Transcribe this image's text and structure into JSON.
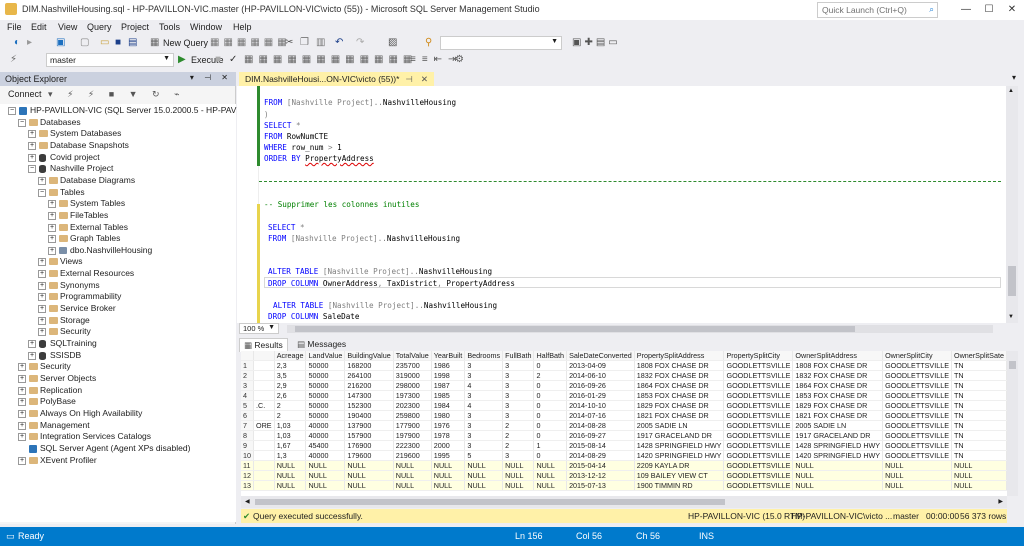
{
  "window": {
    "title": "DIM.NashvilleHousing.sql - HP-PAVILLON-VIC.master (HP-PAVILLON-VIC\\victo (55)) - Microsoft SQL Server Management Studio",
    "quick_launch_placeholder": "Quick Launch (Ctrl+Q)"
  },
  "menu": [
    "File",
    "Edit",
    "View",
    "Query",
    "Project",
    "Tools",
    "Window",
    "Help"
  ],
  "toolbar": {
    "new_query": "New Query",
    "database": "master",
    "execute": "Execute"
  },
  "object_explorer": {
    "title": "Object Explorer",
    "connect": "Connect",
    "nodes": [
      {
        "label": "HP-PAVILLON-VIC (SQL Server 15.0.2000.5 - HP-PAVILLON-",
        "icon": "server-icon",
        "exp": "−"
      },
      {
        "label": "Databases",
        "icon": "folder-icon",
        "exp": "−"
      },
      {
        "label": "System Databases",
        "icon": "folder-icon",
        "exp": "+"
      },
      {
        "label": "Database Snapshots",
        "icon": "folder-icon",
        "exp": "+"
      },
      {
        "label": "Covid project",
        "icon": "database-icon",
        "exp": "+"
      },
      {
        "label": "Nashville Project",
        "icon": "database-icon",
        "exp": "−"
      },
      {
        "label": "Database Diagrams",
        "icon": "folder-icon",
        "exp": "+"
      },
      {
        "label": "Tables",
        "icon": "folder-icon",
        "exp": "−"
      },
      {
        "label": "System Tables",
        "icon": "folder-icon",
        "exp": "+"
      },
      {
        "label": "FileTables",
        "icon": "folder-icon",
        "exp": "+"
      },
      {
        "label": "External Tables",
        "icon": "folder-icon",
        "exp": "+"
      },
      {
        "label": "Graph Tables",
        "icon": "folder-icon",
        "exp": "+"
      },
      {
        "label": "dbo.NashvilleHousing",
        "icon": "table-icon",
        "exp": "+"
      },
      {
        "label": "Views",
        "icon": "folder-icon",
        "exp": "+"
      },
      {
        "label": "External Resources",
        "icon": "folder-icon",
        "exp": "+"
      },
      {
        "label": "Synonyms",
        "icon": "folder-icon",
        "exp": "+"
      },
      {
        "label": "Programmability",
        "icon": "folder-icon",
        "exp": "+"
      },
      {
        "label": "Service Broker",
        "icon": "folder-icon",
        "exp": "+"
      },
      {
        "label": "Storage",
        "icon": "folder-icon",
        "exp": "+"
      },
      {
        "label": "Security",
        "icon": "folder-icon",
        "exp": "+"
      },
      {
        "label": "SQLTraining",
        "icon": "database-icon",
        "exp": "+"
      },
      {
        "label": "SSISDB",
        "icon": "database-icon",
        "exp": "+"
      },
      {
        "label": "Security",
        "icon": "folder-icon",
        "exp": "+"
      },
      {
        "label": "Server Objects",
        "icon": "folder-icon",
        "exp": "+"
      },
      {
        "label": "Replication",
        "icon": "folder-icon",
        "exp": "+"
      },
      {
        "label": "PolyBase",
        "icon": "folder-icon",
        "exp": "+"
      },
      {
        "label": "Always On High Availability",
        "icon": "folder-icon",
        "exp": "+"
      },
      {
        "label": "Management",
        "icon": "folder-icon",
        "exp": "+"
      },
      {
        "label": "Integration Services Catalogs",
        "icon": "folder-icon",
        "exp": "+"
      },
      {
        "label": "SQL Server Agent (Agent XPs disabled)",
        "icon": "agent-icon",
        "exp": ""
      },
      {
        "label": "XEvent Profiler",
        "icon": "folder-icon",
        "exp": "+"
      }
    ]
  },
  "editor": {
    "tab_label": "DIM.NashvilleHousi...ON-VIC\\victo (55))*",
    "zoom": "100 %",
    "lines": [
      "FROM [Nashville Project]..NashvilleHousing",
      ")",
      "SELECT *",
      "FROM RowNumCTE",
      "WHERE row_num > 1",
      "ORDER BY PropertyAddress",
      "-- Supprimer les colonnes inutiles",
      "SELECT *",
      "FROM [Nashville Project]..NashvilleHousing",
      "ALTER TABLE [Nashville Project]..NashvilleHousing",
      "DROP COLUMN OwnerAddress, TaxDistrict, PropertyAddress",
      "ALTER TABLE [Nashville Project]..NashvilleHousing",
      "DROP COLUMN SaleDate"
    ]
  },
  "results": {
    "tabs": [
      "Results",
      "Messages"
    ],
    "columns": [
      "",
      "",
      "Acreage",
      "LandValue",
      "BuildingValue",
      "TotalValue",
      "YearBuilt",
      "Bedrooms",
      "FullBath",
      "HalfBath",
      "SaleDateConverted",
      "PropertySplitAddress",
      "PropertySplitCity",
      "OwnerSplitAddress",
      "OwnerSplitCity",
      "OwnerSplitSate"
    ],
    "rows": [
      [
        "1",
        "",
        "2,3",
        "50000",
        "168200",
        "235700",
        "1986",
        "3",
        "3",
        "0",
        "2013-04-09",
        "1808  FOX CHASE DR",
        "GOODLETTSVILLE",
        "1808  FOX CHASE DR",
        "GOODLETTSVILLE",
        "TN"
      ],
      [
        "2",
        "",
        "3,5",
        "50000",
        "264100",
        "319000",
        "1998",
        "3",
        "3",
        "2",
        "2014-06-10",
        "1832  FOX CHASE DR",
        "GOODLETTSVILLE",
        "1832  FOX CHASE DR",
        "GOODLETTSVILLE",
        "TN"
      ],
      [
        "3",
        "",
        "2,9",
        "50000",
        "216200",
        "298000",
        "1987",
        "4",
        "3",
        "0",
        "2016-09-26",
        "1864 FOX CHASE  DR",
        "GOODLETTSVILLE",
        "1864  FOX CHASE DR",
        "GOODLETTSVILLE",
        "TN"
      ],
      [
        "4",
        "",
        "2,6",
        "50000",
        "147300",
        "197300",
        "1985",
        "3",
        "3",
        "0",
        "2016-01-29",
        "1853  FOX CHASE DR",
        "GOODLETTSVILLE",
        "1853  FOX CHASE DR",
        "GOODLETTSVILLE",
        "TN"
      ],
      [
        "5",
        ".C.",
        "2",
        "50000",
        "152300",
        "202300",
        "1984",
        "4",
        "3",
        "0",
        "2014-10-10",
        "1829  FOX CHASE DR",
        "GOODLETTSVILLE",
        "1829  FOX CHASE DR",
        "GOODLETTSVILLE",
        "TN"
      ],
      [
        "6",
        "",
        "2",
        "50000",
        "190400",
        "259800",
        "1980",
        "3",
        "3",
        "0",
        "2014-07-16",
        "1821  FOX CHASE DR",
        "GOODLETTSVILLE",
        "1821  FOX CHASE DR",
        "GOODLETTSVILLE",
        "TN"
      ],
      [
        "7",
        "ORE",
        "1,03",
        "40000",
        "137900",
        "177900",
        "1976",
        "3",
        "2",
        "0",
        "2014-08-28",
        "2005  SADIE LN",
        "GOODLETTSVILLE",
        "2005  SADIE LN",
        "GOODLETTSVILLE",
        "TN"
      ],
      [
        "8",
        "",
        "1,03",
        "40000",
        "157900",
        "197900",
        "1978",
        "3",
        "2",
        "0",
        "2016-09-27",
        "1917 GRACELAND  DR",
        "GOODLETTSVILLE",
        "1917  GRACELAND DR",
        "GOODLETTSVILLE",
        "TN"
      ],
      [
        "9",
        "",
        "1,67",
        "45400",
        "176900",
        "222300",
        "2000",
        "3",
        "2",
        "1",
        "2015-08-14",
        "1428  SPRINGFIELD HWY",
        "GOODLETTSVILLE",
        "1428  SPRINGFIELD HWY",
        "GOODLETTSVILLE",
        "TN"
      ],
      [
        "10",
        "",
        "1,3",
        "40000",
        "179600",
        "219600",
        "1995",
        "5",
        "3",
        "0",
        "2014-08-29",
        "1420  SPRINGFIELD HWY",
        "GOODLETTSVILLE",
        "1420  SPRINGFIELD HWY",
        "GOODLETTSVILLE",
        "TN"
      ],
      [
        "11",
        "",
        "NULL",
        "NULL",
        "NULL",
        "NULL",
        "NULL",
        "NULL",
        "NULL",
        "NULL",
        "2015-04-14",
        "2209  KAYLA DR",
        "GOODLETTSVILLE",
        "NULL",
        "NULL",
        "NULL"
      ],
      [
        "12",
        "",
        "NULL",
        "NULL",
        "NULL",
        "NULL",
        "NULL",
        "NULL",
        "NULL",
        "NULL",
        "2013-12-12",
        "109  BAILEY VIEW CT",
        "GOODLETTSVILLE",
        "NULL",
        "NULL",
        "NULL"
      ],
      [
        "13",
        "",
        "NULL",
        "NULL",
        "NULL",
        "NULL",
        "NULL",
        "NULL",
        "NULL",
        "NULL",
        "2015-07-13",
        "1900  TIMMIN RD",
        "GOODLETTSVILLE",
        "NULL",
        "NULL",
        "NULL"
      ]
    ]
  },
  "query_status": {
    "message": "Query executed successfully.",
    "server": "HP-PAVILLON-VIC (15.0 RTM)",
    "user": "HP-PAVILLON-VIC\\victo ...",
    "db": "master",
    "time": "00:00:00",
    "rows": "56 373 rows"
  },
  "statusbar": {
    "ready": "Ready",
    "ln": "Ln 156",
    "col": "Col 56",
    "ch": "Ch 56",
    "ins": "INS"
  }
}
